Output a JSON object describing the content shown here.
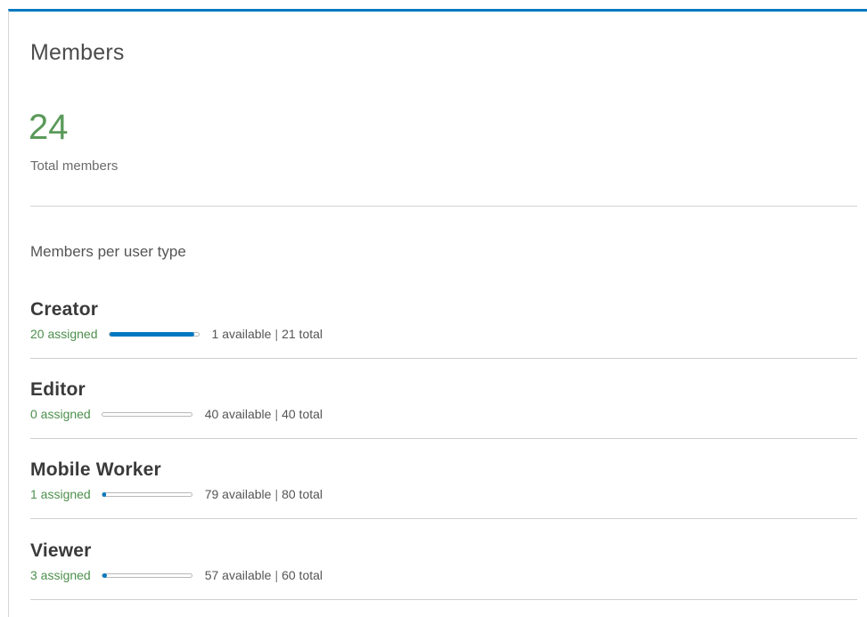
{
  "panel": {
    "title": "Members",
    "total_count": "24",
    "total_label": "Total members",
    "section_label": "Members per user type",
    "accent_color": "#0079c1",
    "count_color": "#5a9a5a"
  },
  "user_types": [
    {
      "name": "Creator",
      "assigned_text": "20 assigned",
      "available_text": "1 available",
      "total_text": "21 total",
      "assigned_fraction": 0.952
    },
    {
      "name": "Editor",
      "assigned_text": "0 assigned",
      "available_text": "40 available",
      "total_text": "40 total",
      "assigned_fraction": 0
    },
    {
      "name": "Mobile Worker",
      "assigned_text": "1 assigned",
      "available_text": "79 available",
      "total_text": "80 total",
      "assigned_fraction": 0.0125
    },
    {
      "name": "Viewer",
      "assigned_text": "3 assigned",
      "available_text": "57 available",
      "total_text": "60 total",
      "assigned_fraction": 0.05
    }
  ]
}
